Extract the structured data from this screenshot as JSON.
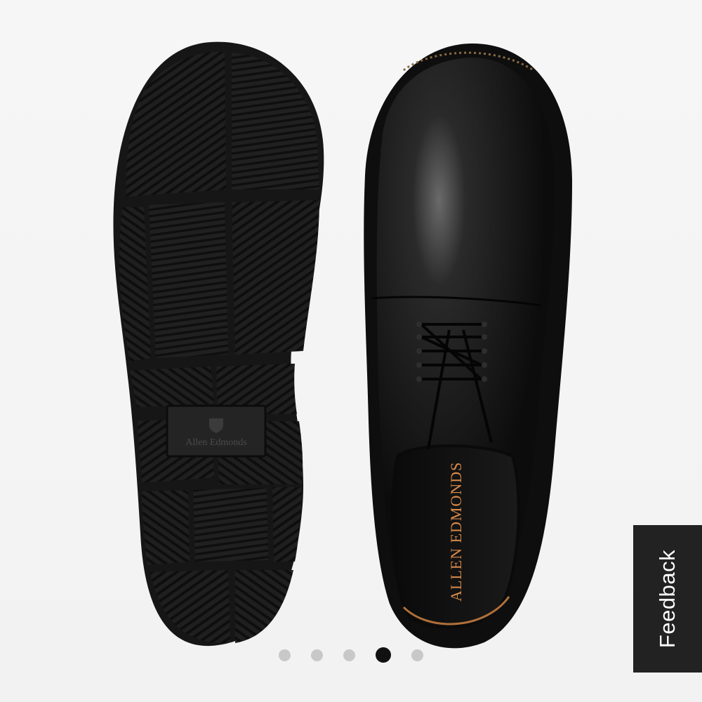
{
  "product_image": {
    "sole_logo_text": "Allen Edmonds",
    "insole_brand_text": "ALLEN EDMONDS",
    "colors": {
      "background": "#f4f4f4",
      "leather": "#141414",
      "sole": "#1e1e1e",
      "insole_text": "#d98a4a"
    }
  },
  "carousel": {
    "total_slides": 5,
    "active_index": 3
  },
  "feedback": {
    "label": "Feedback"
  }
}
